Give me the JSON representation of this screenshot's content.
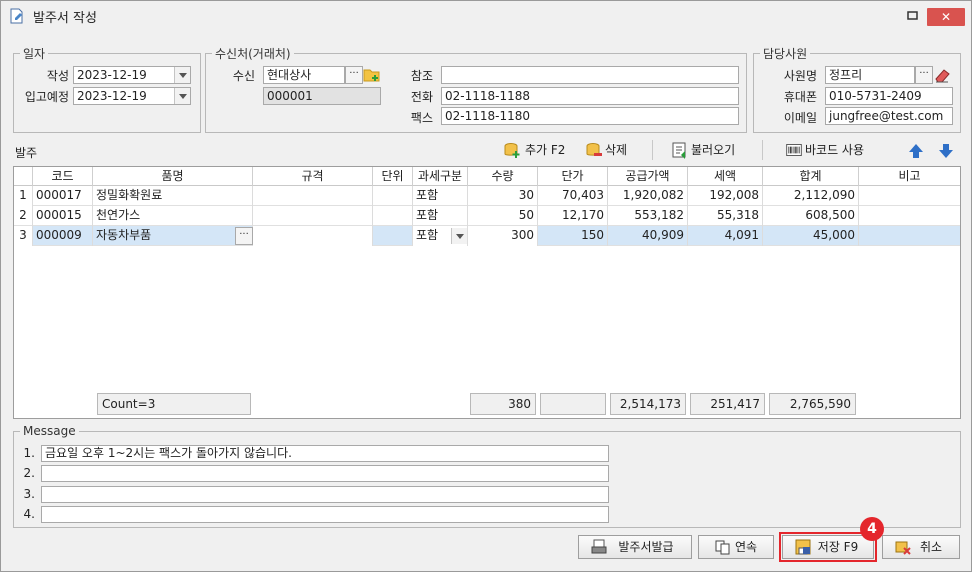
{
  "window": {
    "title": "발주서 작성",
    "close_label": "✕"
  },
  "date_group": {
    "legend": "일자",
    "write_label": "작성",
    "write_value": "2023-12-19",
    "arrival_label": "입고예정",
    "arrival_value": "2023-12-19"
  },
  "recipient_group": {
    "legend": "수신처(거래처)",
    "recipient_label": "수신",
    "recipient_value": "현대상사",
    "recipient_code": "000001",
    "ref_label": "참조",
    "ref_value": "",
    "phone_label": "전화",
    "phone_value": "02-1118-1188",
    "fax_label": "팩스",
    "fax_value": "02-1118-1180"
  },
  "staff_group": {
    "legend": "담당사원",
    "name_label": "사원명",
    "name_value": "정프리",
    "mobile_label": "휴대폰",
    "mobile_value": "010-5731-2409",
    "email_label": "이메일",
    "email_value": "jungfree@test.com"
  },
  "order_section": {
    "label": "발주",
    "add_label": "추가 F2",
    "delete_label": "삭제",
    "load_label": "불러오기",
    "barcode_label": "바코드 사용"
  },
  "table": {
    "headers": [
      "코드",
      "품명",
      "규격",
      "단위",
      "과세구분",
      "수량",
      "단가",
      "공급가액",
      "세액",
      "합계",
      "비고"
    ],
    "rows": [
      {
        "no": "1",
        "code": "000017",
        "name": "정밀화확원료",
        "spec": "",
        "unit": "",
        "tax": "포함",
        "qty": "30",
        "price": "70,403",
        "supply": "1,920,082",
        "vat": "192,008",
        "total": "2,112,090",
        "note": ""
      },
      {
        "no": "2",
        "code": "000015",
        "name": "천연가스",
        "spec": "",
        "unit": "",
        "tax": "포함",
        "qty": "50",
        "price": "12,170",
        "supply": "553,182",
        "vat": "55,318",
        "total": "608,500",
        "note": ""
      },
      {
        "no": "3",
        "code": "000009",
        "name": "자동차부품",
        "spec": "",
        "unit": "",
        "tax": "포함",
        "qty": "300",
        "price": "150",
        "supply": "40,909",
        "vat": "4,091",
        "total": "45,000",
        "note": ""
      }
    ],
    "footer": {
      "count": "Count=3",
      "qty": "380",
      "supply": "2,514,173",
      "vat": "251,417",
      "total": "2,765,590"
    }
  },
  "message": {
    "legend": "Message",
    "lines": [
      {
        "num": "1.",
        "text": "금요일 오후 1~2시는 팩스가 돌아가지 않습니다."
      },
      {
        "num": "2.",
        "text": ""
      },
      {
        "num": "3.",
        "text": ""
      },
      {
        "num": "4.",
        "text": ""
      }
    ]
  },
  "buttons": {
    "issue": "발주서발급",
    "continuous": "연속",
    "save": "저장 F9",
    "cancel": "취소"
  },
  "annotation_badge": "4",
  "colors": {
    "selected_row": "#d4e6f7",
    "close_button": "#d9534f",
    "highlight": "#e4262c"
  }
}
